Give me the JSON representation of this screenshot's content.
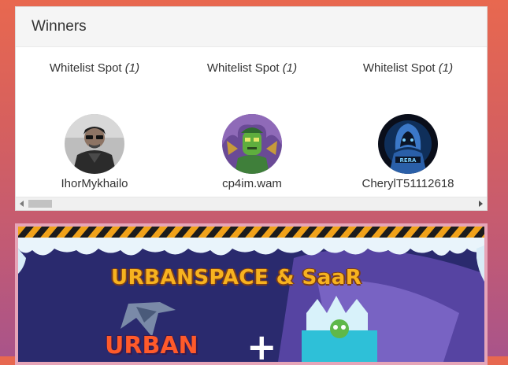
{
  "winners_card": {
    "title": "Winners",
    "winners": [
      {
        "prize": "Whitelist Spot",
        "count": "(1)",
        "name": "IhorMykhailo",
        "avatar": "person-photo-icon"
      },
      {
        "prize": "Whitelist Spot",
        "count": "(1)",
        "name": "cp4im.wam",
        "avatar": "green-character-icon"
      },
      {
        "prize": "Whitelist Spot",
        "count": "(1)",
        "name": "CherylT51112618",
        "avatar": "hooded-figure-icon"
      }
    ]
  },
  "banner": {
    "title": "URBANSPACE & SaaR",
    "logo_text": "URBAN",
    "plus": "+"
  }
}
